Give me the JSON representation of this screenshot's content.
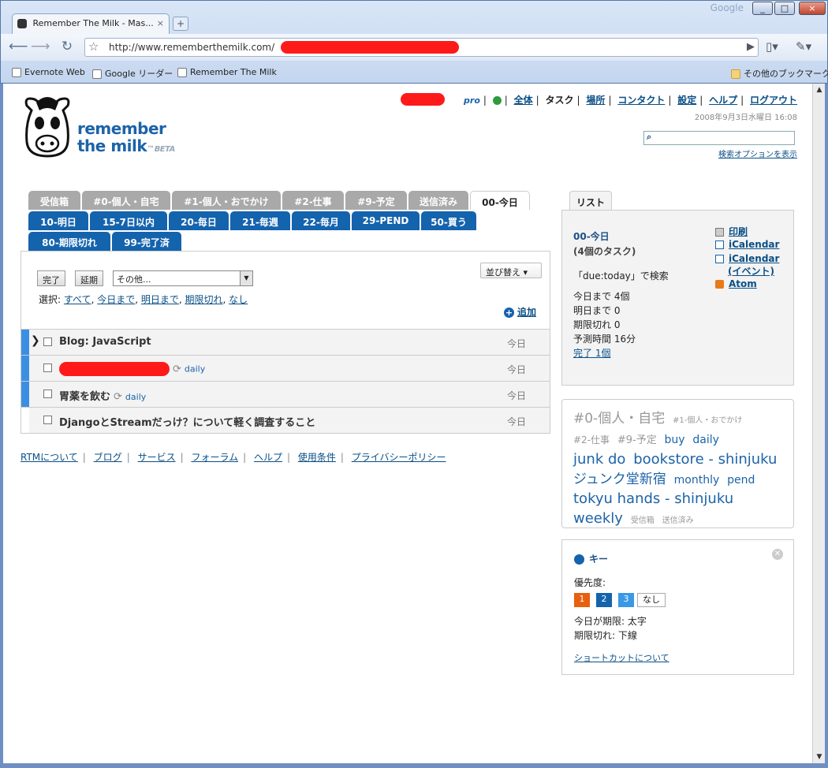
{
  "browser": {
    "tab_title": "Remember The Milk - Mas...",
    "tab_close": "×",
    "new_tab": "+",
    "brand": "Google",
    "win_minimize": "_",
    "win_maximize": "□",
    "win_close": "×",
    "url": "http://www.rememberthemilk.com/",
    "bookmarks": [
      "Evernote Web",
      "Google リーダー",
      "Remember The Milk"
    ],
    "other_bookmarks": "その他のブックマーク"
  },
  "logo": {
    "line1": "remember",
    "line2": "the milk",
    "beta": "™BETA"
  },
  "topnav": {
    "pro": "pro",
    "items": [
      "全体",
      "タスク",
      "場所",
      "コンタクト",
      "設定",
      "ヘルプ",
      "ログアウト"
    ],
    "separator": "|"
  },
  "datetime": "2008年9月3日水曜日 16:08",
  "search": {
    "options_link": "検索オプションを表示",
    "icon": "search-icon"
  },
  "tabs_row1": [
    "受信箱",
    "#0-個人・自宅",
    "#1-個人・おでかけ",
    "#2-仕事",
    "#9-予定",
    "送信済み",
    "00-今日"
  ],
  "tabs_row2": [
    "10-明日",
    "15-7日以内",
    "20-毎日",
    "21-毎週",
    "22-毎月",
    "29-PEND",
    "50-買う"
  ],
  "tabs_row3": [
    "80-期限切れ",
    "99-完了済"
  ],
  "controls": {
    "complete": "完了",
    "postpone": "延期",
    "more": "その他...",
    "sort": "並び替え ▾",
    "select_label": "選択:",
    "select_links": [
      "すべて",
      "今日まで",
      "明日まで",
      "期限切れ",
      "なし"
    ],
    "add": "追加"
  },
  "tasks": [
    {
      "name": "Blog: JavaScript",
      "due": "今日",
      "priority_color": "#3b8fe3",
      "tag": ""
    },
    {
      "name": "",
      "due": "今日",
      "priority_color": "#3b8fe3",
      "tag": "daily",
      "repeat": "⟳"
    },
    {
      "name": "胃薬を飲む",
      "due": "今日",
      "priority_color": "#3b8fe3",
      "tag": "daily",
      "repeat": "⟳"
    },
    {
      "name": "DjangoとStreamだっけ？について軽く調査すること",
      "due": "今日",
      "priority_color": "#ffffff",
      "tag": ""
    }
  ],
  "footer_links": [
    "RTMについて",
    "ブログ",
    "サービス",
    "フォーラム",
    "ヘルプ",
    "使用条件",
    "プライバシーポリシー"
  ],
  "list_panel": {
    "tab": "リスト",
    "title": "00-今日",
    "count": "(4個のタスク)",
    "search_text": "「due:today」で検索",
    "stats": [
      "今日まで 4個",
      "明日まで 0",
      "期限切れ 0",
      "予測時間 16分"
    ],
    "completed": "完了 1個",
    "feeds": [
      "印刷",
      "iCalendar",
      "iCalendar",
      "(イベント)",
      "Atom"
    ]
  },
  "tag_cloud": [
    {
      "text": "#0-個人・自宅",
      "size": 17,
      "color": "gray"
    },
    {
      "text": "#1-個人・おでかけ",
      "size": 10,
      "color": "gray"
    },
    {
      "text": "#2-仕事",
      "size": 12,
      "color": "gray"
    },
    {
      "text": "#9-予定",
      "size": 13,
      "color": "gray"
    },
    {
      "text": "buy",
      "size": 14,
      "color": "blue"
    },
    {
      "text": "daily",
      "size": 14,
      "color": "blue"
    },
    {
      "text": "junk do",
      "size": 18,
      "color": "blue"
    },
    {
      "text": "bookstore - shinjuku",
      "size": 18,
      "color": "blue"
    },
    {
      "text": "ジュンク堂新宿",
      "size": 17,
      "color": "blue"
    },
    {
      "text": "monthly",
      "size": 14,
      "color": "blue"
    },
    {
      "text": "pend",
      "size": 14,
      "color": "blue"
    },
    {
      "text": "tokyu hands - shinjuku",
      "size": 18,
      "color": "blue"
    },
    {
      "text": "weekly",
      "size": 18,
      "color": "blue"
    },
    {
      "text": "受信箱",
      "size": 10,
      "color": "gray"
    },
    {
      "text": "送信済み",
      "size": 10,
      "color": "gray"
    }
  ],
  "key_panel": {
    "title": "キー",
    "priority_label": "優先度:",
    "priorities": [
      "1",
      "2",
      "3",
      "なし"
    ],
    "due_today": "今日が期限: 太字",
    "overdue": "期限切れ: 下線",
    "shortcuts": "ショートカットについて",
    "colors": {
      "p1": "#e8600f",
      "p2": "#1463ad",
      "p3": "#3b98e6"
    }
  }
}
